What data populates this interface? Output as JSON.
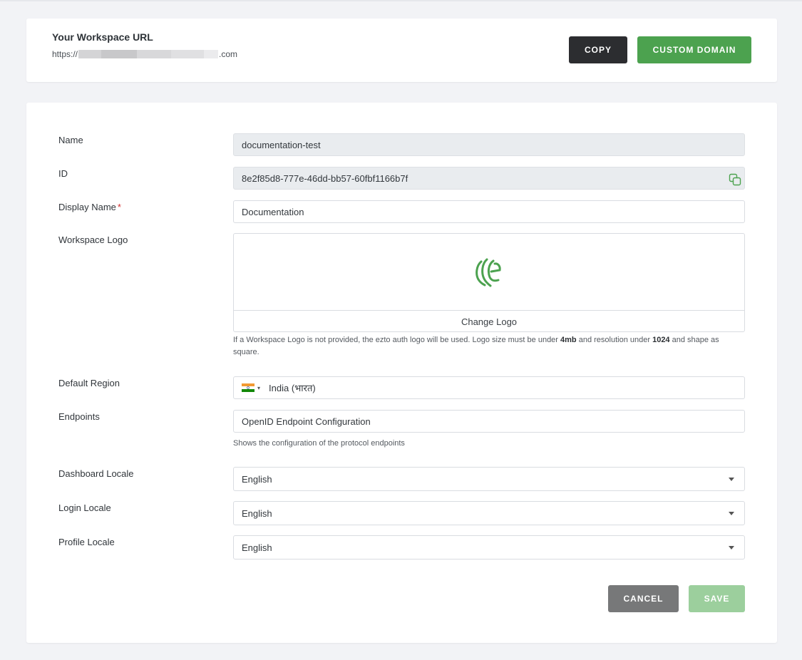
{
  "workspace_url": {
    "title": "Your Workspace URL",
    "prefix": "https://",
    "suffix": ".com",
    "copy_label": "COPY",
    "custom_domain_label": "CUSTOM DOMAIN"
  },
  "form": {
    "name": {
      "label": "Name",
      "value": "documentation-test"
    },
    "id": {
      "label": "ID",
      "value": "8e2f85d8-777e-46dd-bb57-60fbf1166b7f"
    },
    "display_name": {
      "label": "Display Name",
      "required_mark": "*",
      "value": "Documentation"
    },
    "workspace_logo": {
      "label": "Workspace Logo",
      "change_label": "Change Logo",
      "hint_prefix": "If a Workspace Logo is not provided, the ezto auth logo will be used. Logo size must be under ",
      "hint_size": "4mb",
      "hint_middle": " and resolution under ",
      "hint_resolution": "1024",
      "hint_suffix": " and shape as square."
    },
    "default_region": {
      "label": "Default Region",
      "value": "India (भारत)"
    },
    "endpoints": {
      "label": "Endpoints",
      "value": "OpenID Endpoint Configuration",
      "hint": "Shows the configuration of the protocol endpoints"
    },
    "dashboard_locale": {
      "label": "Dashboard Locale",
      "value": "English"
    },
    "login_locale": {
      "label": "Login Locale",
      "value": "English"
    },
    "profile_locale": {
      "label": "Profile Locale",
      "value": "English"
    }
  },
  "actions": {
    "cancel_label": "CANCEL",
    "save_label": "SAVE"
  },
  "colors": {
    "primary_green": "#4ca24f",
    "dark": "#2c2d30",
    "required": "#d32f2f"
  }
}
